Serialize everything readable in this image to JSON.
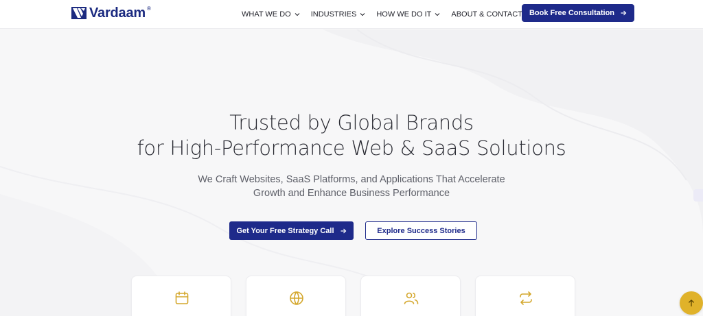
{
  "brand": {
    "name": "Vardaam",
    "registered": "®",
    "color": "#1b2a80",
    "accent": "#e0b22a"
  },
  "nav": {
    "items": [
      {
        "label": "WHAT WE DO",
        "icon": "chevron-down-icon"
      },
      {
        "label": "INDUSTRIES",
        "icon": "chevron-down-icon"
      },
      {
        "label": "HOW WE DO IT",
        "icon": "chevron-down-icon"
      },
      {
        "label": "ABOUT & CONTACT",
        "icon": "chevron-down-icon"
      }
    ],
    "cta_label": "Book Free Consultation"
  },
  "hero": {
    "title_line1": "Trusted by Global Brands",
    "title_line2": "for High-Performance Web & SaaS Solutions",
    "subtitle_line1": "We Craft Websites, SaaS Platforms, and Applications That Accelerate",
    "subtitle_line2": "Growth and Enhance Business Performance",
    "primary_cta": "Get Your Free Strategy Call",
    "secondary_cta": "Explore Success Stories"
  },
  "cards": [
    {
      "icon": "calendar-icon"
    },
    {
      "icon": "globe-icon"
    },
    {
      "icon": "users-icon"
    },
    {
      "icon": "repeat-icon"
    }
  ],
  "floating": {
    "scroll_top_icon": "arrow-up-icon"
  }
}
